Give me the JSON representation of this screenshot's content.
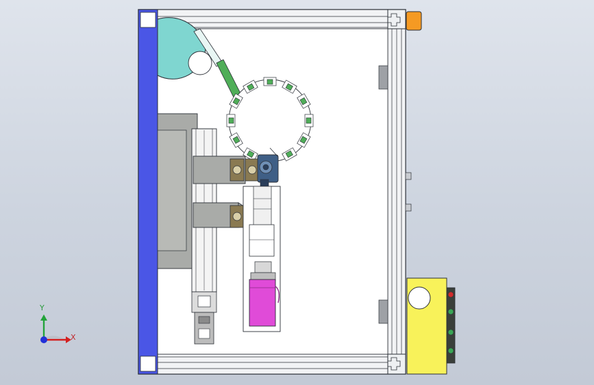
{
  "view": {
    "name": "cad-assembly-top-view",
    "background": "#cfd6e0"
  },
  "colors": {
    "frame_outline": "#2b2f36",
    "frame_profile": "#e8eaee",
    "guard_blue": "#4a56e6",
    "hopper_cyan": "#7fd6d0",
    "rotary_green": "#4fae58",
    "slide_gray": "#a9aba8",
    "servo_magenta": "#e04bd8",
    "control_box_yellow": "#f8f25a",
    "corner_orange": "#f59a23",
    "motor_blue": "#3f5f86"
  },
  "triad": {
    "x_label": "X",
    "y_label": "Y",
    "x_color": "#d42020",
    "y_color": "#22a33a",
    "origin_color": "#2230d8"
  }
}
